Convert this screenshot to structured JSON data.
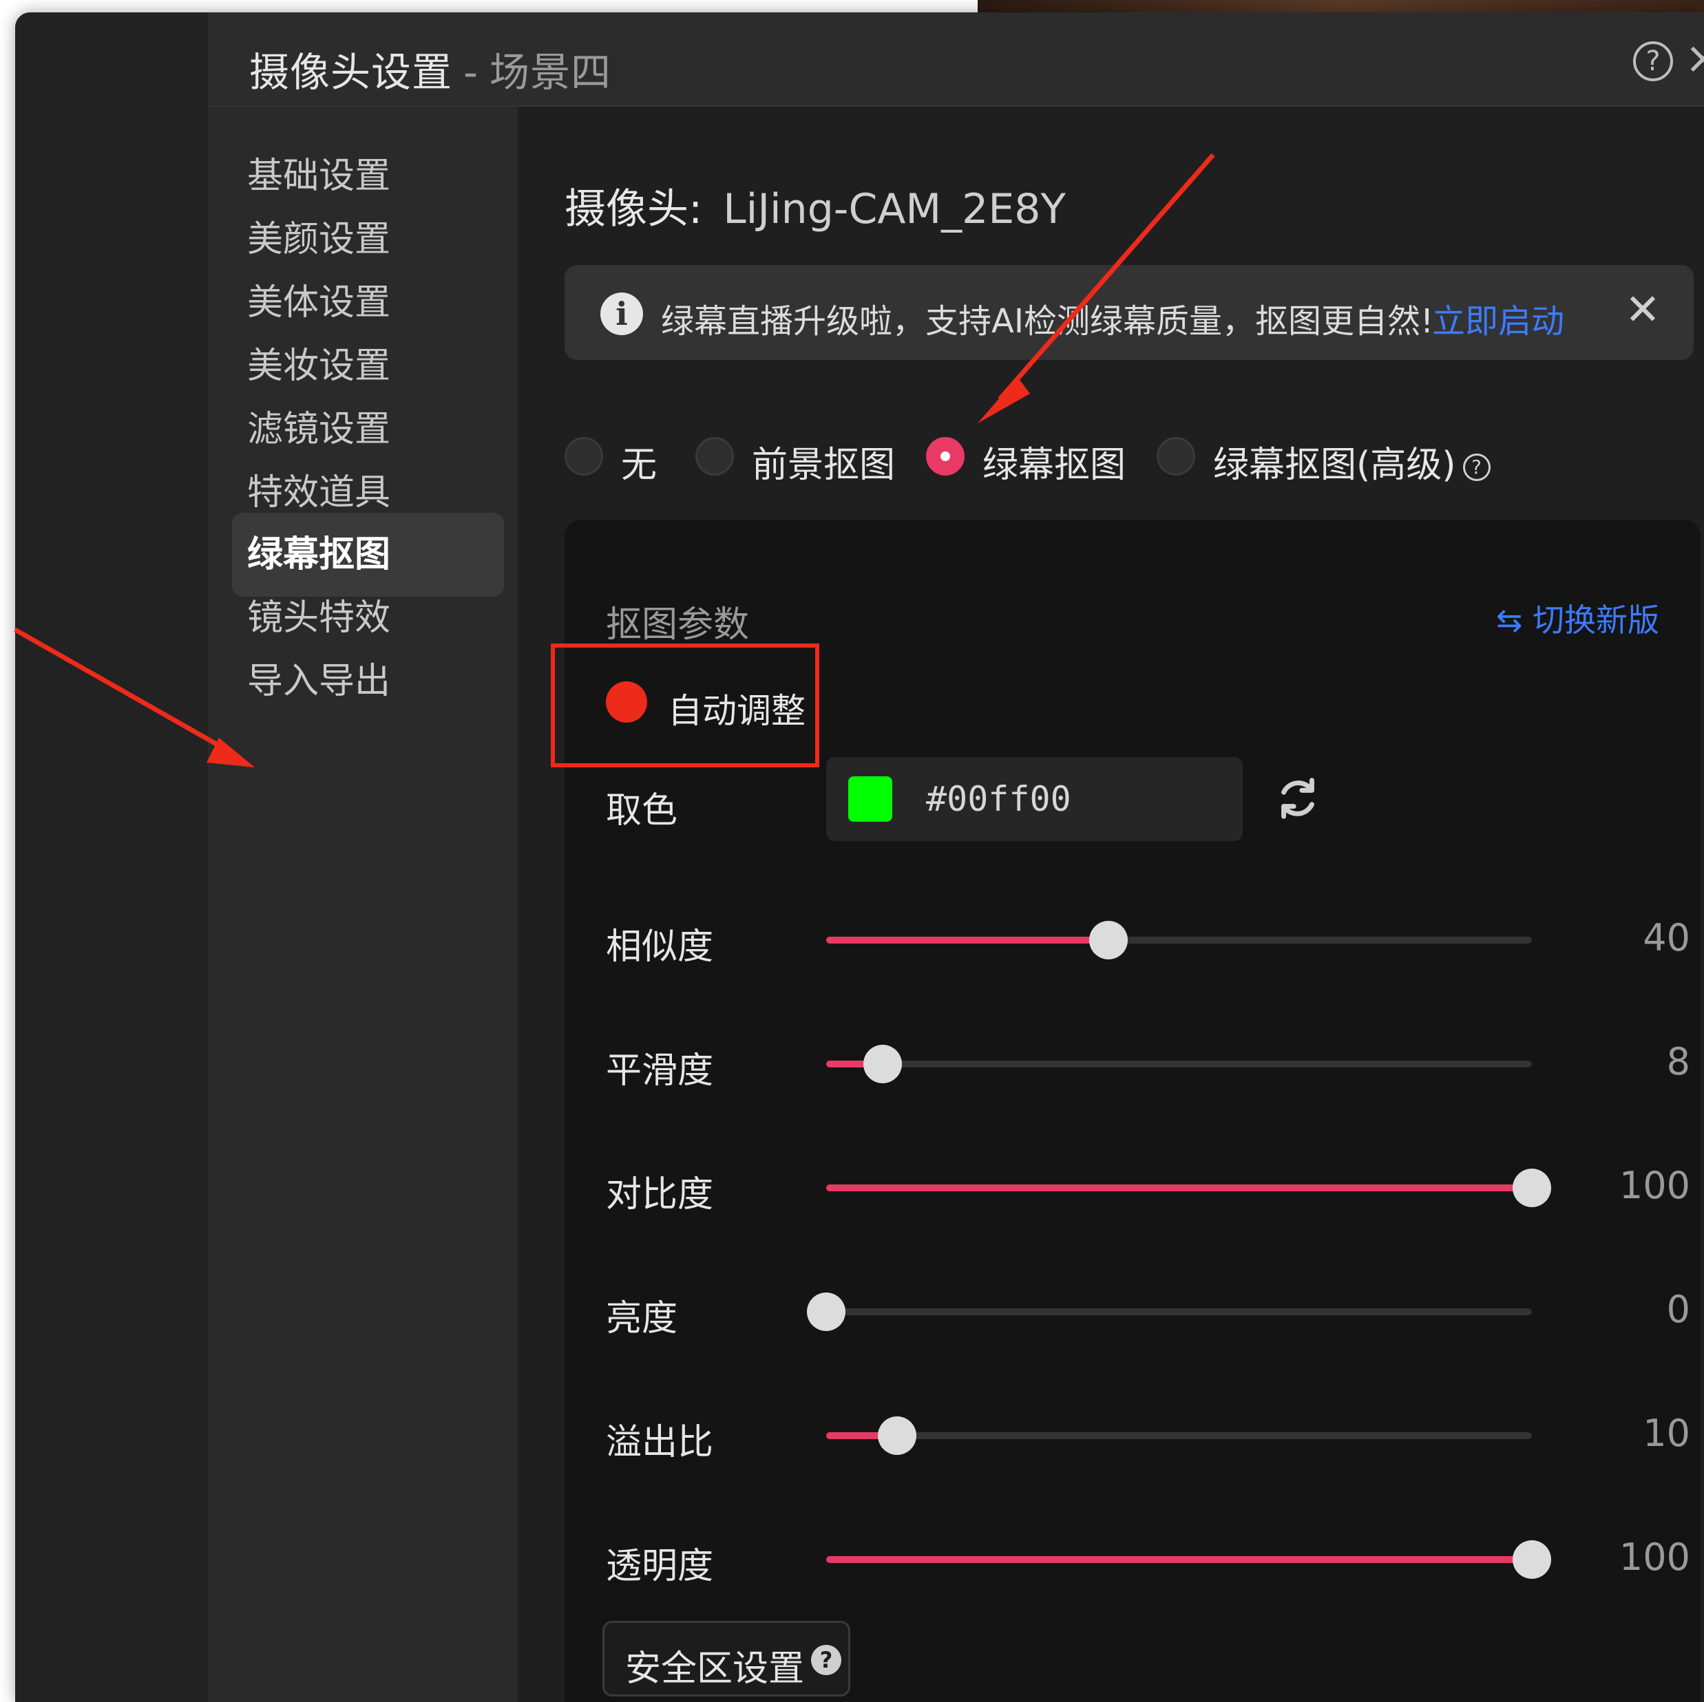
{
  "window": {
    "title": "摄像头设置",
    "separator": "-",
    "scene": "场景四"
  },
  "sidebar": {
    "items": [
      {
        "label": "基础设置"
      },
      {
        "label": "美颜设置"
      },
      {
        "label": "美体设置"
      },
      {
        "label": "美妆设置"
      },
      {
        "label": "滤镜设置"
      },
      {
        "label": "特效道具"
      },
      {
        "label": "绿幕抠图",
        "active": true
      },
      {
        "label": "镜头特效"
      },
      {
        "label": "导入导出"
      }
    ]
  },
  "camera": {
    "label": "摄像头:",
    "name": "LiJing-CAM_2E8Y"
  },
  "banner": {
    "text": "绿幕直播升级啦，支持AI检测绿幕质量，抠图更自然!",
    "link": "立即启动",
    "close": "✕"
  },
  "modes": {
    "options": [
      {
        "label": "无",
        "checked": false
      },
      {
        "label": "前景抠图",
        "checked": false
      },
      {
        "label": "绿幕抠图",
        "checked": true
      },
      {
        "label": "绿幕抠图(高级)",
        "checked": false,
        "help": "?"
      }
    ]
  },
  "params": {
    "title": "抠图参数",
    "switch_link": "⇆ 切换新版",
    "auto_adjust": "自动调整",
    "color_label": "取色",
    "color_value": "#00ff00",
    "sliders": [
      {
        "label": "相似度",
        "value": "40",
        "percent": 40
      },
      {
        "label": "平滑度",
        "value": "8",
        "percent": 8
      },
      {
        "label": "对比度",
        "value": "100",
        "percent": 100
      },
      {
        "label": "亮度",
        "value": "0",
        "percent": 0
      },
      {
        "label": "溢出比",
        "value": "10",
        "percent": 10
      },
      {
        "label": "透明度",
        "value": "100",
        "percent": 100
      }
    ],
    "safe_zone": "安全区设置",
    "safe_zone_help": "?"
  },
  "colors": {
    "accent": "#e83a64",
    "link": "#3d7bff",
    "annotation": "#ee2a1a",
    "picked": "#00ff00"
  },
  "icons": {
    "help": "help-circle-icon",
    "close": "close-icon",
    "info": "info-icon",
    "refresh": "refresh-icon"
  }
}
